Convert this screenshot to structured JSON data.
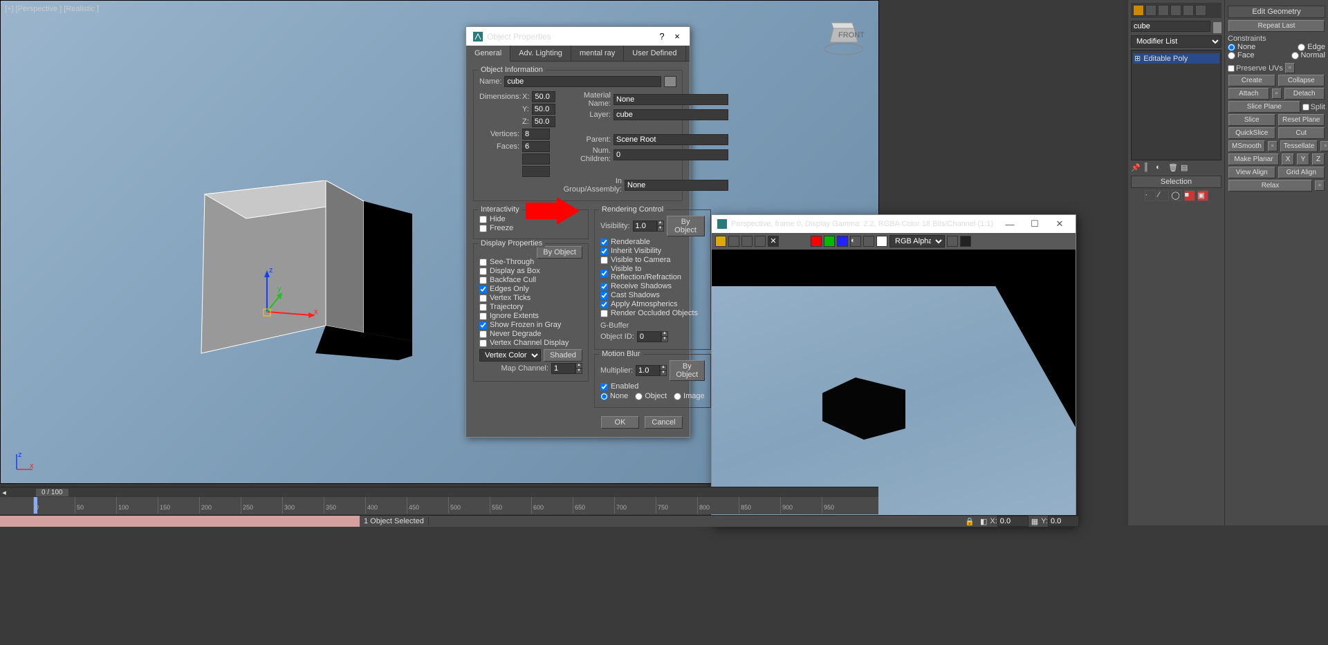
{
  "viewport": {
    "label": "[+] [Perspective ] [Realistic ]",
    "viewcube_face": "FRONT"
  },
  "dialog": {
    "title": "Object Properties",
    "help": "?",
    "close": "×",
    "tabs": [
      "General",
      "Adv. Lighting",
      "mental ray",
      "User Defined"
    ],
    "object_info": {
      "title": "Object Information",
      "name_label": "Name:",
      "name": "cube",
      "dim_label": "Dimensions:",
      "x_label": "X:",
      "x": "50.0",
      "y_label": "Y:",
      "y": "50.0",
      "z_label": "Z:",
      "z": "50.0",
      "mat_label": "Material Name:",
      "mat": "None",
      "layer_label": "Layer:",
      "layer": "cube",
      "vert_label": "Vertices:",
      "vert": "8",
      "faces_label": "Faces:",
      "faces": "6",
      "parent_label": "Parent:",
      "parent": "Scene Root",
      "numc_label": "Num. Children:",
      "numc": "0",
      "grp_label": "In Group/Assembly:",
      "grp": "None"
    },
    "interactivity": {
      "title": "Interactivity",
      "hide": "Hide",
      "freeze": "Freeze"
    },
    "display": {
      "title": "Display Properties",
      "by_object": "By Object",
      "items": [
        "See-Through",
        "Display as Box",
        "Backface Cull",
        "Edges Only",
        "Vertex Ticks",
        "Trajectory",
        "Ignore Extents",
        "Show Frozen in Gray",
        "Never Degrade",
        "Vertex Channel Display"
      ],
      "checked": [
        false,
        false,
        false,
        true,
        false,
        false,
        false,
        true,
        false,
        false
      ],
      "vertex_color": "Vertex Color",
      "shaded": "Shaded",
      "map_channel_label": "Map Channel:",
      "map_channel": "1"
    },
    "rendering": {
      "title": "Rendering Control",
      "vis_label": "Visibility:",
      "vis": "1.0",
      "by_object": "By Object",
      "items": [
        "Renderable",
        "Inherit Visibility",
        "Visible to Camera",
        "Visible to Reflection/Refraction",
        "Receive Shadows",
        "Cast Shadows",
        "Apply Atmospherics",
        "Render Occluded Objects"
      ],
      "checked": [
        true,
        true,
        false,
        true,
        true,
        true,
        true,
        false
      ],
      "gbuffer_title": "G-Buffer",
      "objid_label": "Object ID:",
      "objid": "0"
    },
    "motion": {
      "title": "Motion Blur",
      "mult_label": "Multiplier:",
      "mult": "1.0",
      "by_object": "By Object",
      "enabled": "Enabled",
      "none": "None",
      "object": "Object",
      "image": "Image"
    },
    "ok": "OK",
    "cancel": "Cancel"
  },
  "cmd_panel": {
    "name": "cube",
    "modifier_list": "Modifier List",
    "stack_item": "Editable Poly",
    "selection_title": "Selection"
  },
  "edit_panel": {
    "title": "Edit Geometry",
    "repeat": "Repeat Last",
    "constraints": "Constraints",
    "c_none": "None",
    "c_edge": "Edge",
    "c_face": "Face",
    "c_normal": "Normal",
    "preserve": "Preserve UVs",
    "create": "Create",
    "collapse": "Collapse",
    "attach": "Attach",
    "detach": "Detach",
    "slice_plane": "Slice Plane",
    "split": "Split",
    "slice": "Slice",
    "reset_plane": "Reset Plane",
    "quickslice": "QuickSlice",
    "cut": "Cut",
    "msmooth": "MSmooth",
    "tessellate": "Tessellate",
    "make_planar": "Make Planar",
    "x": "X",
    "y": "Y",
    "z": "Z",
    "view_align": "View Align",
    "grid_align": "Grid Align",
    "relax": "Relax"
  },
  "render_win": {
    "title": "Perspective, frame 0, Display Gamma: 2.2, RGBA Color 16 Bits/Channel (1:1)",
    "alpha_select": "RGB Alpha"
  },
  "timeline": {
    "frame": "0 / 100",
    "ticks": [
      0,
      50,
      100,
      150,
      200,
      250,
      300,
      350,
      400,
      450,
      500,
      550,
      600,
      650,
      700,
      750,
      800,
      850,
      900,
      950
    ]
  },
  "status": {
    "sel": "1 Object Selected",
    "x_label": "X:",
    "x": "0.0",
    "y_label": "Y:",
    "y": "0.0"
  }
}
